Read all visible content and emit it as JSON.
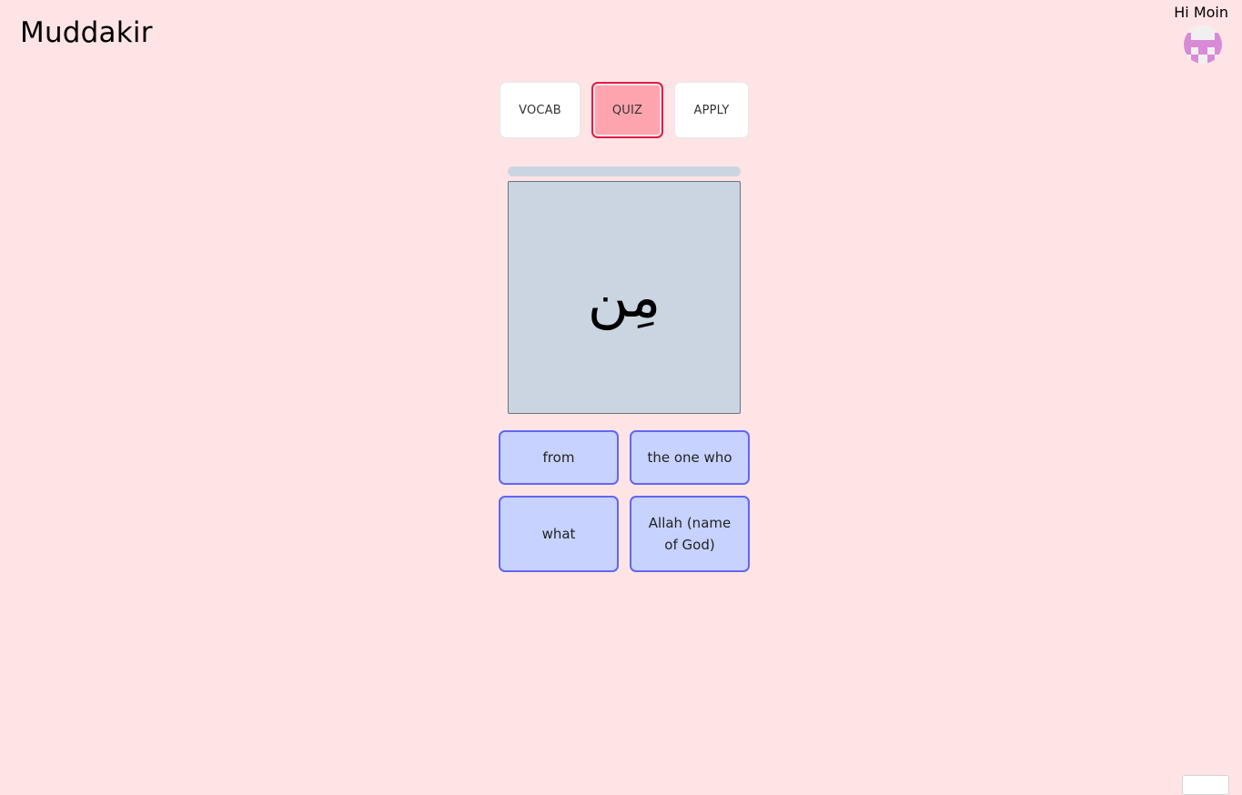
{
  "app": {
    "title": "Muddakir"
  },
  "user": {
    "greeting": "Hi Moin",
    "avatar_icon": "pixel-avatar-icon"
  },
  "mode_tabs": {
    "items": [
      {
        "label": "VOCAB",
        "active": false
      },
      {
        "label": "QUIZ",
        "active": true
      },
      {
        "label": "APPLY",
        "active": false
      }
    ]
  },
  "quiz": {
    "progress": 0,
    "word": "مِن",
    "options": [
      {
        "label": "from"
      },
      {
        "label": "the one who"
      },
      {
        "label": "what"
      },
      {
        "label": "Allah (name of God)"
      }
    ]
  },
  "colors": {
    "background": "#ffe4e6",
    "active_tab": "#fda4af",
    "active_tab_border": "#e11d48",
    "card": "#cbd5e1",
    "option": "#c7d2fe",
    "option_border": "#6366f1"
  }
}
